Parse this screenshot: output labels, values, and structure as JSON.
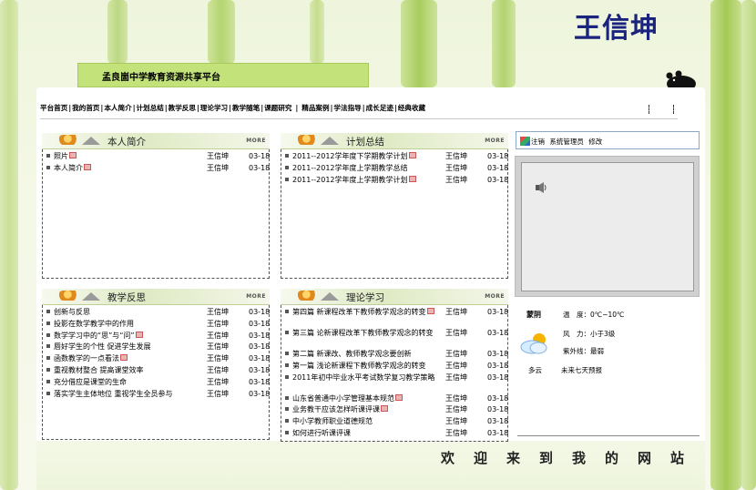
{
  "header": {
    "owner_name": "王信坤",
    "site_title": "孟良崮中学教育资源共享平台"
  },
  "nav": {
    "items": [
      "平台首页",
      "我的首页",
      "本人简介",
      "计划总结",
      "教学反思",
      "理论学习",
      "教学随笔",
      "课题研究",
      "精品案例",
      "学法指导",
      "成长足迹",
      "经典收藏"
    ]
  },
  "panels": {
    "intro": {
      "title": "本人简介",
      "more": "MORE",
      "rows": [
        {
          "title": "照片",
          "author": "王信坤",
          "date": "03-18",
          "new": true
        },
        {
          "title": "本人简介",
          "author": "王信坤",
          "date": "03-18",
          "new": true
        }
      ]
    },
    "plan": {
      "title": "计划总结",
      "more": "MORE",
      "rows": [
        {
          "title": "2011--2012学年度下学期教学计划",
          "author": "王信坤",
          "date": "03-18",
          "new": true
        },
        {
          "title": "2011--2012学年度上学期教学总结",
          "author": "王信坤",
          "date": "03-18",
          "new": false
        },
        {
          "title": "2011--2012学年度上学期教学计划",
          "author": "王信坤",
          "date": "03-18",
          "new": true
        }
      ]
    },
    "reflection": {
      "title": "教学反思",
      "more": "MORE",
      "rows": [
        {
          "title": "创新与反思",
          "author": "王信坤",
          "date": "03-18",
          "new": false
        },
        {
          "title": "投影在数学教学中的作用",
          "author": "王信坤",
          "date": "03-18",
          "new": false
        },
        {
          "title": "数学学习中的“思”与“问”",
          "author": "王信坤",
          "date": "03-18",
          "new": true
        },
        {
          "title": "唇好学生的个性 促进学生发展",
          "author": "王信坤",
          "date": "03-18",
          "new": false
        },
        {
          "title": "函数教学的一点看法",
          "author": "王信坤",
          "date": "03-18",
          "new": true
        },
        {
          "title": "重视教材整合 提高课堂效率",
          "author": "王信坤",
          "date": "03-18",
          "new": false
        },
        {
          "title": "充分借应是课堂的生命",
          "author": "王信坤",
          "date": "03-18",
          "new": false
        },
        {
          "title": "落实学生主体地位 重视学生全员参与",
          "author": "王信坤",
          "date": "03-18",
          "new": false
        }
      ]
    },
    "theory": {
      "title": "理论学习",
      "more": "MORE",
      "rows": [
        {
          "title": "第四篇 新课程改革下教师教学观念的转变",
          "author": "王信坤",
          "date": "03-18",
          "new": true,
          "tall": true
        },
        {
          "title": "第三篇 论新课程改革下教师教学观念的转变",
          "author": "王信坤",
          "date": "03-18",
          "new": false,
          "tall": true
        },
        {
          "title": "第二篇 新课改、教师教学观念要创新",
          "author": "王信坤",
          "date": "03-18",
          "new": false
        },
        {
          "title": "第一篇 浅论新课程下教师教学观念的转变",
          "author": "王信坤",
          "date": "03-18",
          "new": false
        },
        {
          "title": "2011年初中毕业水平考试数学复习教学策略",
          "author": "王信坤",
          "date": "03-18",
          "new": false,
          "tall": true
        },
        {
          "title": "山东省普通中小学管理基本规范",
          "author": "王信坤",
          "date": "03-18",
          "new": true
        },
        {
          "title": "业务教干应该怎样听课评课",
          "author": "王信坤",
          "date": "03-18",
          "new": true
        },
        {
          "title": "中小学教师职业道德规范",
          "author": "王信坤",
          "date": "03-18",
          "new": false
        },
        {
          "title": "如何进行听课评课",
          "author": "王信坤",
          "date": "03-18",
          "new": false
        }
      ]
    }
  },
  "user_box": {
    "logout": "注销",
    "role": "系统管理员",
    "edit": "修改"
  },
  "weather": {
    "city": "蒙阴",
    "temp_label": "温　度：",
    "temp_value": "0℃~10℃",
    "wind_label": "风　力：",
    "wind_value": "小于3级",
    "uv_label": "紫外线：",
    "uv_value": "最弱",
    "forecast_label": "多云",
    "forecast_link": "未来七天预报"
  },
  "footer": {
    "welcome": "欢迎来到我的网站"
  },
  "colors": {
    "banner": "#c3e27a",
    "owner_name": "#1a237e",
    "panel_border": "#555555"
  }
}
